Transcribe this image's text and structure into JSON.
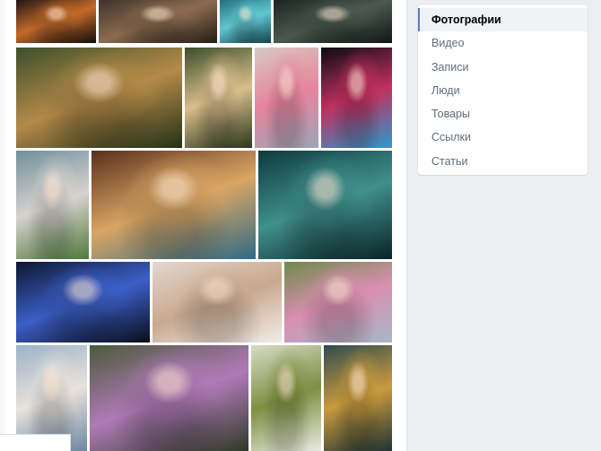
{
  "side_menu": {
    "items": [
      {
        "label": "Фотографии",
        "active": true
      },
      {
        "label": "Видео",
        "active": false
      },
      {
        "label": "Записи",
        "active": false
      },
      {
        "label": "Люди",
        "active": false
      },
      {
        "label": "Товары",
        "active": false
      },
      {
        "label": "Ссылки",
        "active": false
      },
      {
        "label": "Статьи",
        "active": false
      }
    ],
    "accent_color": "#5181b8"
  },
  "photos": [
    {
      "name": "photo-portrait-neon-orange",
      "colors": [
        "#1a1212",
        "#c46a2a",
        "#0e0b0b"
      ]
    },
    {
      "name": "photo-girl-forest-dark",
      "colors": [
        "#3a3128",
        "#8b6b4f",
        "#241c16"
      ]
    },
    {
      "name": "photo-girl-teal-light",
      "colors": [
        "#1f6b78",
        "#5fc7d1",
        "#12414a"
      ]
    },
    {
      "name": "photo-dark-forest-bear",
      "colors": [
        "#1b2220",
        "#4a5a50",
        "#101514"
      ]
    },
    {
      "name": "photo-girl-giant-snail",
      "colors": [
        "#3d4f2b",
        "#b48a48",
        "#223016"
      ]
    },
    {
      "name": "photo-two-blonde-girls",
      "colors": [
        "#3c4e2a",
        "#d9bd8b",
        "#2a361c"
      ]
    },
    {
      "name": "photo-girl-pink-flower-hair",
      "colors": [
        "#d7c9c4",
        "#e7849d",
        "#9aa6b8"
      ]
    },
    {
      "name": "photo-neon-couple-embrace",
      "colors": [
        "#0b0b12",
        "#c0305f",
        "#2a9bcf"
      ]
    },
    {
      "name": "photo-girl-flower-field",
      "colors": [
        "#6f8f9c",
        "#d7d2cf",
        "#4f7a3a"
      ]
    },
    {
      "name": "photo-painted-blonde-portrait",
      "colors": [
        "#5a2f1c",
        "#d9a564",
        "#2e6b86"
      ]
    },
    {
      "name": "photo-underwater-girl",
      "colors": [
        "#0f3a3f",
        "#3f8f8c",
        "#0a2326"
      ]
    },
    {
      "name": "photo-lightning-storm",
      "colors": [
        "#0e1630",
        "#3b5fc7",
        "#0a0d1b"
      ]
    },
    {
      "name": "photo-little-girl-flowers",
      "colors": [
        "#e3d6cf",
        "#c9a98f",
        "#f3ece7"
      ]
    },
    {
      "name": "photo-girls-pink-dress",
      "colors": [
        "#6d8a4a",
        "#d98fb0",
        "#a6b6c9"
      ]
    },
    {
      "name": "photo-girl-white-dress-birds",
      "colors": [
        "#9cb2c8",
        "#e8e2dc",
        "#6d87a3"
      ]
    },
    {
      "name": "photo-mother-daughter-lavender",
      "colors": [
        "#4a5a3a",
        "#b07ab8",
        "#2f3a27"
      ]
    },
    {
      "name": "photo-boy-meadow-kite",
      "colors": [
        "#d7dbc7",
        "#7f8f42",
        "#e9ebe1"
      ]
    },
    {
      "name": "photo-boy-autumn-field",
      "colors": [
        "#2f4b4f",
        "#c99a3d",
        "#1e3234"
      ]
    }
  ]
}
